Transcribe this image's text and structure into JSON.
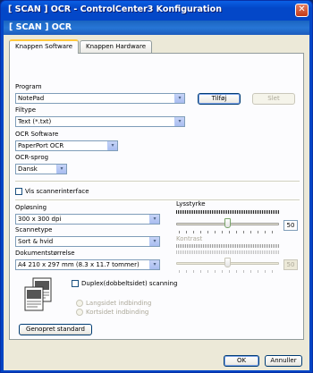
{
  "window": {
    "title": "[ SCAN ]   OCR - ControlCenter3 Konfiguration",
    "close_glyph": "✕"
  },
  "header": {
    "title": "[ SCAN ]   OCR"
  },
  "tabs": [
    {
      "label": "Knappen Software",
      "active": true
    },
    {
      "label": "Knappen Hardware",
      "active": false
    }
  ],
  "program": {
    "label": "Program",
    "value": "NotePad",
    "add_button": "Tilføj",
    "delete_button": "Slet"
  },
  "filetype": {
    "label": "Filtype",
    "value": "Text (*.txt)"
  },
  "ocr_software": {
    "label": "OCR Software",
    "value": "PaperPort OCR"
  },
  "ocr_language": {
    "label": "OCR-sprog",
    "value": "Dansk"
  },
  "scanner_interface": {
    "label": "Vis scannerinterface",
    "checked": false
  },
  "resolution": {
    "label": "Opløsning",
    "value": "300 x 300 dpi"
  },
  "scan_type": {
    "label": "Scannetype",
    "value": "Sort & hvid"
  },
  "document_size": {
    "label": "Dokumentstørrelse",
    "value": "A4 210 x 297 mm (8.3 x 11.7 tommer)"
  },
  "brightness": {
    "label": "Lysstyrke",
    "value": "50",
    "level": 0.5
  },
  "contrast": {
    "label": "Kontrast",
    "value": "50",
    "level": 0.5,
    "enabled": false
  },
  "duplex": {
    "label": "Duplex(dobbeltsidet) scanning",
    "checked": false,
    "long_edge": "Langsidet indbinding",
    "short_edge": "Kortsidet indbinding"
  },
  "buttons": {
    "restore_defaults": "Genopret standard",
    "ok": "OK",
    "cancel": "Annuller"
  },
  "icons": {
    "dropdown": "▾",
    "close": "close-icon"
  },
  "colors": {
    "titlebar": "#0245c4",
    "header_band": "#2776d6",
    "face": "#ece9d8",
    "active_tab_accent": "#ffc83c"
  }
}
